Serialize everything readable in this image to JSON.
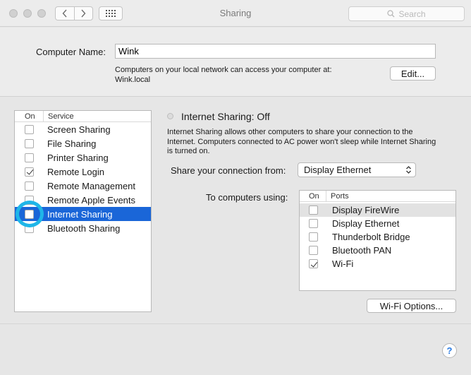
{
  "window": {
    "title": "Sharing"
  },
  "toolbar": {
    "search_placeholder": "Search",
    "back_icon": "chevron-left-icon",
    "forward_icon": "chevron-right-icon",
    "grid_icon": "grid-icon"
  },
  "computer_name": {
    "label": "Computer Name:",
    "value": "Wink",
    "desc_line1": "Computers on your local network can access your computer at:",
    "desc_line2": "Wink.local",
    "edit_label": "Edit..."
  },
  "services": {
    "header_on": "On",
    "header_service": "Service",
    "items": [
      {
        "label": "Screen Sharing",
        "checked": false
      },
      {
        "label": "File Sharing",
        "checked": false
      },
      {
        "label": "Printer Sharing",
        "checked": false
      },
      {
        "label": "Remote Login",
        "checked": true
      },
      {
        "label": "Remote Management",
        "checked": false
      },
      {
        "label": "Remote Apple Events",
        "checked": false
      },
      {
        "label": "Internet Sharing",
        "checked": false,
        "selected": true
      },
      {
        "label": "Bluetooth Sharing",
        "checked": false
      }
    ]
  },
  "detail": {
    "status": "Internet Sharing: Off",
    "description": "Internet Sharing allows other computers to share your connection to the Internet. Computers connected to AC power won't sleep while Internet Sharing is turned on.",
    "share_from_label": "Share your connection from:",
    "share_from_value": "Display Ethernet",
    "to_label": "To computers using:",
    "ports_header_on": "On",
    "ports_header_ports": "Ports",
    "ports": [
      {
        "label": "Display FireWire",
        "checked": false
      },
      {
        "label": "Display Ethernet",
        "checked": false
      },
      {
        "label": "Thunderbolt Bridge",
        "checked": false
      },
      {
        "label": "Bluetooth PAN",
        "checked": false
      },
      {
        "label": "Wi-Fi",
        "checked": true
      }
    ],
    "wifi_options_label": "Wi-Fi Options..."
  },
  "help": {
    "label": "?"
  },
  "colors": {
    "selection": "#1a66d8",
    "highlight_ring": "#1fb6e8"
  }
}
